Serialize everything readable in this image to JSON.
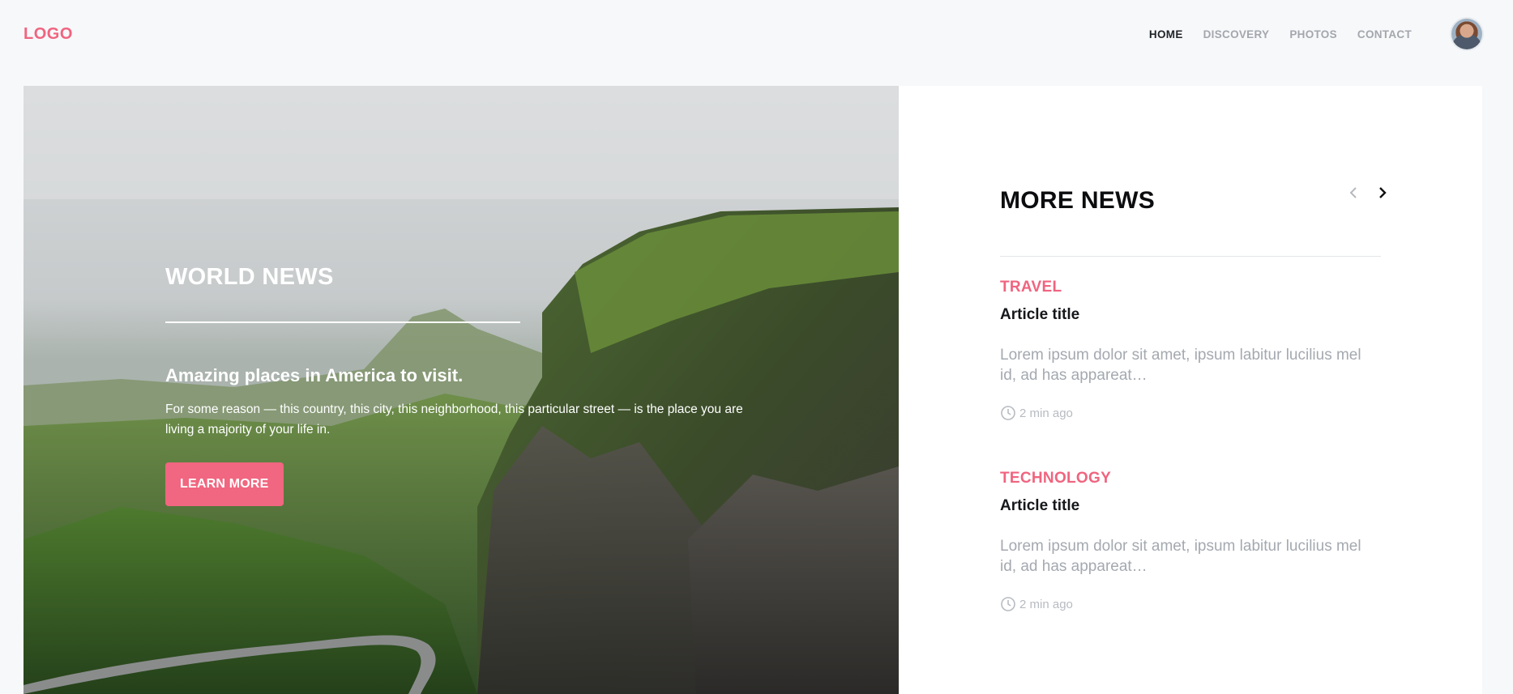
{
  "header": {
    "logo": "LOGO",
    "nav": [
      {
        "label": "HOME",
        "active": true
      },
      {
        "label": "DISCOVERY",
        "active": false
      },
      {
        "label": "PHOTOS",
        "active": false
      },
      {
        "label": "CONTACT",
        "active": false
      }
    ],
    "avatar_icon": "user-avatar"
  },
  "hero": {
    "kicker": "WORLD NEWS",
    "headline": "Amazing places in America to visit.",
    "text": "For some reason — this country, this city, this neighborhood, this particular street — is the place you are living a majority of your life in.",
    "button_label": "LEARN MORE"
  },
  "side": {
    "title": "MORE NEWS",
    "prev_icon": "chevron-left-icon",
    "next_icon": "chevron-right-icon",
    "articles": [
      {
        "category": "TRAVEL",
        "title": "Article title",
        "excerpt": "Lorem ipsum dolor sit amet, ipsum labitur lucilius mel id, ad has appareat…",
        "time": "2 min ago"
      },
      {
        "category": "TECHNOLOGY",
        "title": "Article title",
        "excerpt": "Lorem ipsum dolor sit amet, ipsum labitur lucilius mel id, ad has appareat…",
        "time": "2 min ago"
      }
    ]
  },
  "colors": {
    "accent": "#f0647f",
    "background": "#f7f8fa",
    "panel": "#ffffff",
    "muted_text": "#a4a9b0"
  }
}
